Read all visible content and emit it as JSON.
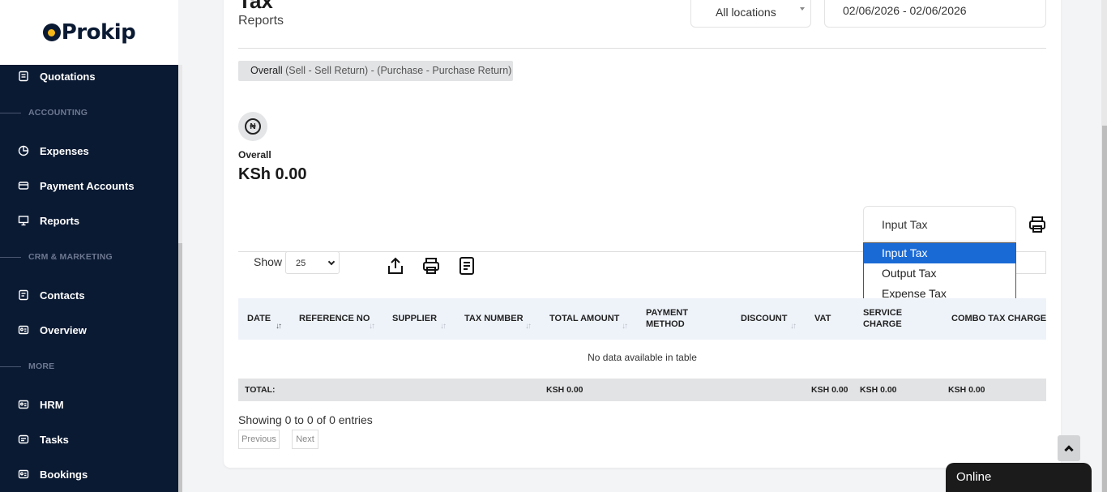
{
  "sidebar": {
    "logo_text": "Prokip",
    "items": [
      {
        "label": "Quotations",
        "icon": "quotation-icon"
      },
      {
        "section": "ACCOUNTING"
      },
      {
        "label": "Expenses",
        "icon": "pie-chart-icon"
      },
      {
        "label": "Payment Accounts",
        "icon": "wallet-icon"
      },
      {
        "label": "Reports",
        "icon": "presentation-icon"
      },
      {
        "section": "CRM & MARKETING"
      },
      {
        "label": "Contacts",
        "icon": "contacts-icon"
      },
      {
        "label": "Overview",
        "icon": "id-card-icon"
      },
      {
        "section": "MORE"
      },
      {
        "label": "HRM",
        "icon": "id-card-icon"
      },
      {
        "label": "Tasks",
        "icon": "tasks-icon"
      },
      {
        "label": "Bookings",
        "icon": "id-card-icon"
      }
    ]
  },
  "header": {
    "title": "Tax",
    "subtitle": "Reports",
    "location": "All locations",
    "date_range": "02/06/2026 - 02/06/2026"
  },
  "summary": {
    "formula_bold": "Overall",
    "formula_rest": " (Sell - Sell Return) - (Purchase - Purchase Return)",
    "currency_symbol": "₦",
    "overall_label": "Overall",
    "overall_value": "KSh 0.00"
  },
  "tax_type": {
    "selected": "Input Tax",
    "options": [
      "Input Tax",
      "Output Tax",
      "Expense Tax"
    ]
  },
  "table_controls": {
    "show_label": "Show",
    "page_size": "25"
  },
  "table": {
    "columns": [
      "DATE",
      "REFERENCE NO",
      "SUPPLIER",
      "TAX NUMBER",
      "TOTAL AMOUNT",
      "PAYMENT METHOD",
      "DISCOUNT",
      "VAT",
      "SERVICE CHARGE",
      "COMBO TAX CHARGE"
    ],
    "empty_text": "No data available in table",
    "footer": {
      "label": "TOTAL:",
      "total_amount": "KSH 0.00",
      "vat": "KSH 0.00",
      "service_charge": "KSH 0.00",
      "combo_tax": "KSH 0.00"
    },
    "showing": "Showing 0 to 0 of 0 entries",
    "prev_label": "Previous",
    "next_label": "Next"
  },
  "chat": {
    "status": "Online"
  },
  "colors": {
    "sidebar_bg": "#0b1a33",
    "accent": "#1a6ad6",
    "logo_accent": "#f5b819"
  }
}
